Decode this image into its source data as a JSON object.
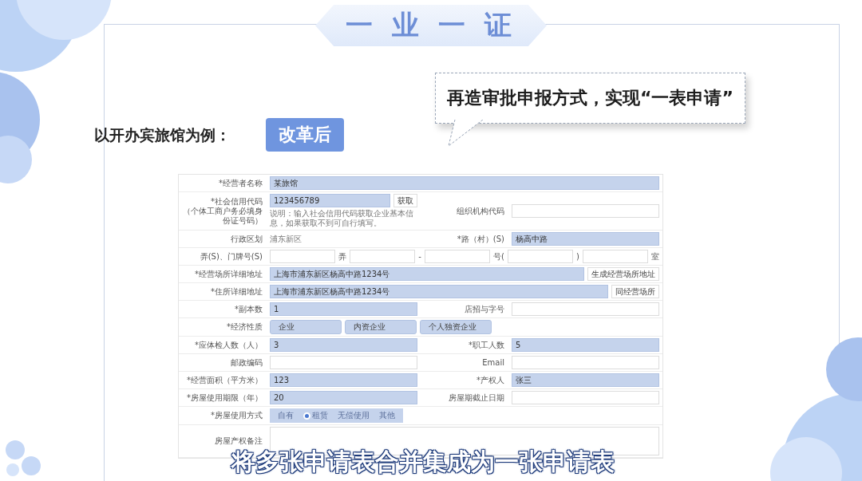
{
  "banner": {
    "title": "一 业 一 证"
  },
  "callout": {
    "text": "再造审批申报方式，实现“一表申请”"
  },
  "example": {
    "label": "以开办宾旅馆为例：",
    "badge": "改革后"
  },
  "form": {
    "rows": [
      {
        "cells": [
          {
            "label": "*经营者名称",
            "field": {
              "kind": "input",
              "value": "某旅馆",
              "filled": true
            }
          }
        ]
      },
      {
        "cells": [
          {
            "label": "*社会信用代码",
            "sublabel": "（个体工商户务必填身份证号码）",
            "field": {
              "kind": "input_button",
              "value": "123456789",
              "filled": true,
              "button": "获取",
              "hint": "说明：输入社会信用代码获取企业基本信息，如果获取不到可自行填写。"
            }
          },
          {
            "label": "组织机构代码",
            "field": {
              "kind": "input",
              "filled": false
            }
          }
        ]
      },
      {
        "cells": [
          {
            "label": "行政区划",
            "field": {
              "kind": "text",
              "value": "浦东新区"
            }
          },
          {
            "label": "*路（村）(S)",
            "field": {
              "kind": "input",
              "value": "杨高中路",
              "filled": true
            }
          }
        ]
      },
      {
        "cells": [
          {
            "label": "弄(S)、门牌号(S)",
            "field": {
              "kind": "segments",
              "parts": [
                {
                  "kind": "input"
                },
                {
                  "kind": "text",
                  "text": "弄"
                },
                {
                  "kind": "input"
                },
                {
                  "kind": "text",
                  "text": "-"
                },
                {
                  "kind": "input"
                },
                {
                  "kind": "text",
                  "text": "号("
                },
                {
                  "kind": "input"
                },
                {
                  "kind": "text",
                  "text": ")"
                },
                {
                  "kind": "input"
                },
                {
                  "kind": "text",
                  "text": "室"
                }
              ]
            }
          }
        ]
      },
      {
        "cells": [
          {
            "label": "*经营场所详细地址",
            "field": {
              "kind": "input_button",
              "value": "上海市浦东新区杨高中路1234号",
              "filled": true,
              "button": "生成经营场所地址"
            }
          }
        ]
      },
      {
        "cells": [
          {
            "label": "*住所详细地址",
            "field": {
              "kind": "input_button",
              "value": "上海市浦东新区杨高中路1234号",
              "filled": true,
              "button": "同经营场所"
            }
          }
        ]
      },
      {
        "cells": [
          {
            "label": "*副本数",
            "field": {
              "kind": "input",
              "value": "1",
              "filled": true
            }
          },
          {
            "label": "店招与字号",
            "field": {
              "kind": "input",
              "filled": false
            }
          }
        ]
      },
      {
        "cells": [
          {
            "label": "*经济性质",
            "field": {
              "kind": "pills",
              "options": [
                "企业",
                "内资企业",
                "个人独资企业"
              ]
            }
          }
        ]
      },
      {
        "cells": [
          {
            "label": "*应体检人数（人）",
            "field": {
              "kind": "input",
              "value": "3",
              "filled": true
            }
          },
          {
            "label": "*职工人数",
            "field": {
              "kind": "input",
              "value": "5",
              "filled": true
            }
          }
        ]
      },
      {
        "cells": [
          {
            "label": "邮政编码",
            "field": {
              "kind": "input",
              "filled": false
            }
          },
          {
            "label": "Email",
            "field": {
              "kind": "input",
              "filled": false
            }
          }
        ]
      },
      {
        "cells": [
          {
            "label": "*经营面积（平方米）",
            "field": {
              "kind": "input",
              "value": "123",
              "filled": true
            }
          },
          {
            "label": "*产权人",
            "field": {
              "kind": "input",
              "value": "张三",
              "filled": true
            }
          }
        ]
      },
      {
        "cells": [
          {
            "label": "*房屋使用期限（年）",
            "field": {
              "kind": "input",
              "value": "20",
              "filled": true
            }
          },
          {
            "label": "房屋期截止日期",
            "field": {
              "kind": "input",
              "filled": false
            }
          }
        ]
      },
      {
        "cells": [
          {
            "label": "*房屋使用方式",
            "field": {
              "kind": "radio",
              "options": [
                {
                  "label": "自有",
                  "selected": false
                },
                {
                  "label": "租赁",
                  "selected": true
                },
                {
                  "label": "无偿使用",
                  "selected": false
                },
                {
                  "label": "其他",
                  "selected": false
                }
              ]
            }
          }
        ]
      },
      {
        "cells": [
          {
            "label": "房屋产权备注",
            "field": {
              "kind": "textarea"
            }
          }
        ]
      }
    ]
  },
  "caption": "将多张申请表合并集成为一张申请表"
}
